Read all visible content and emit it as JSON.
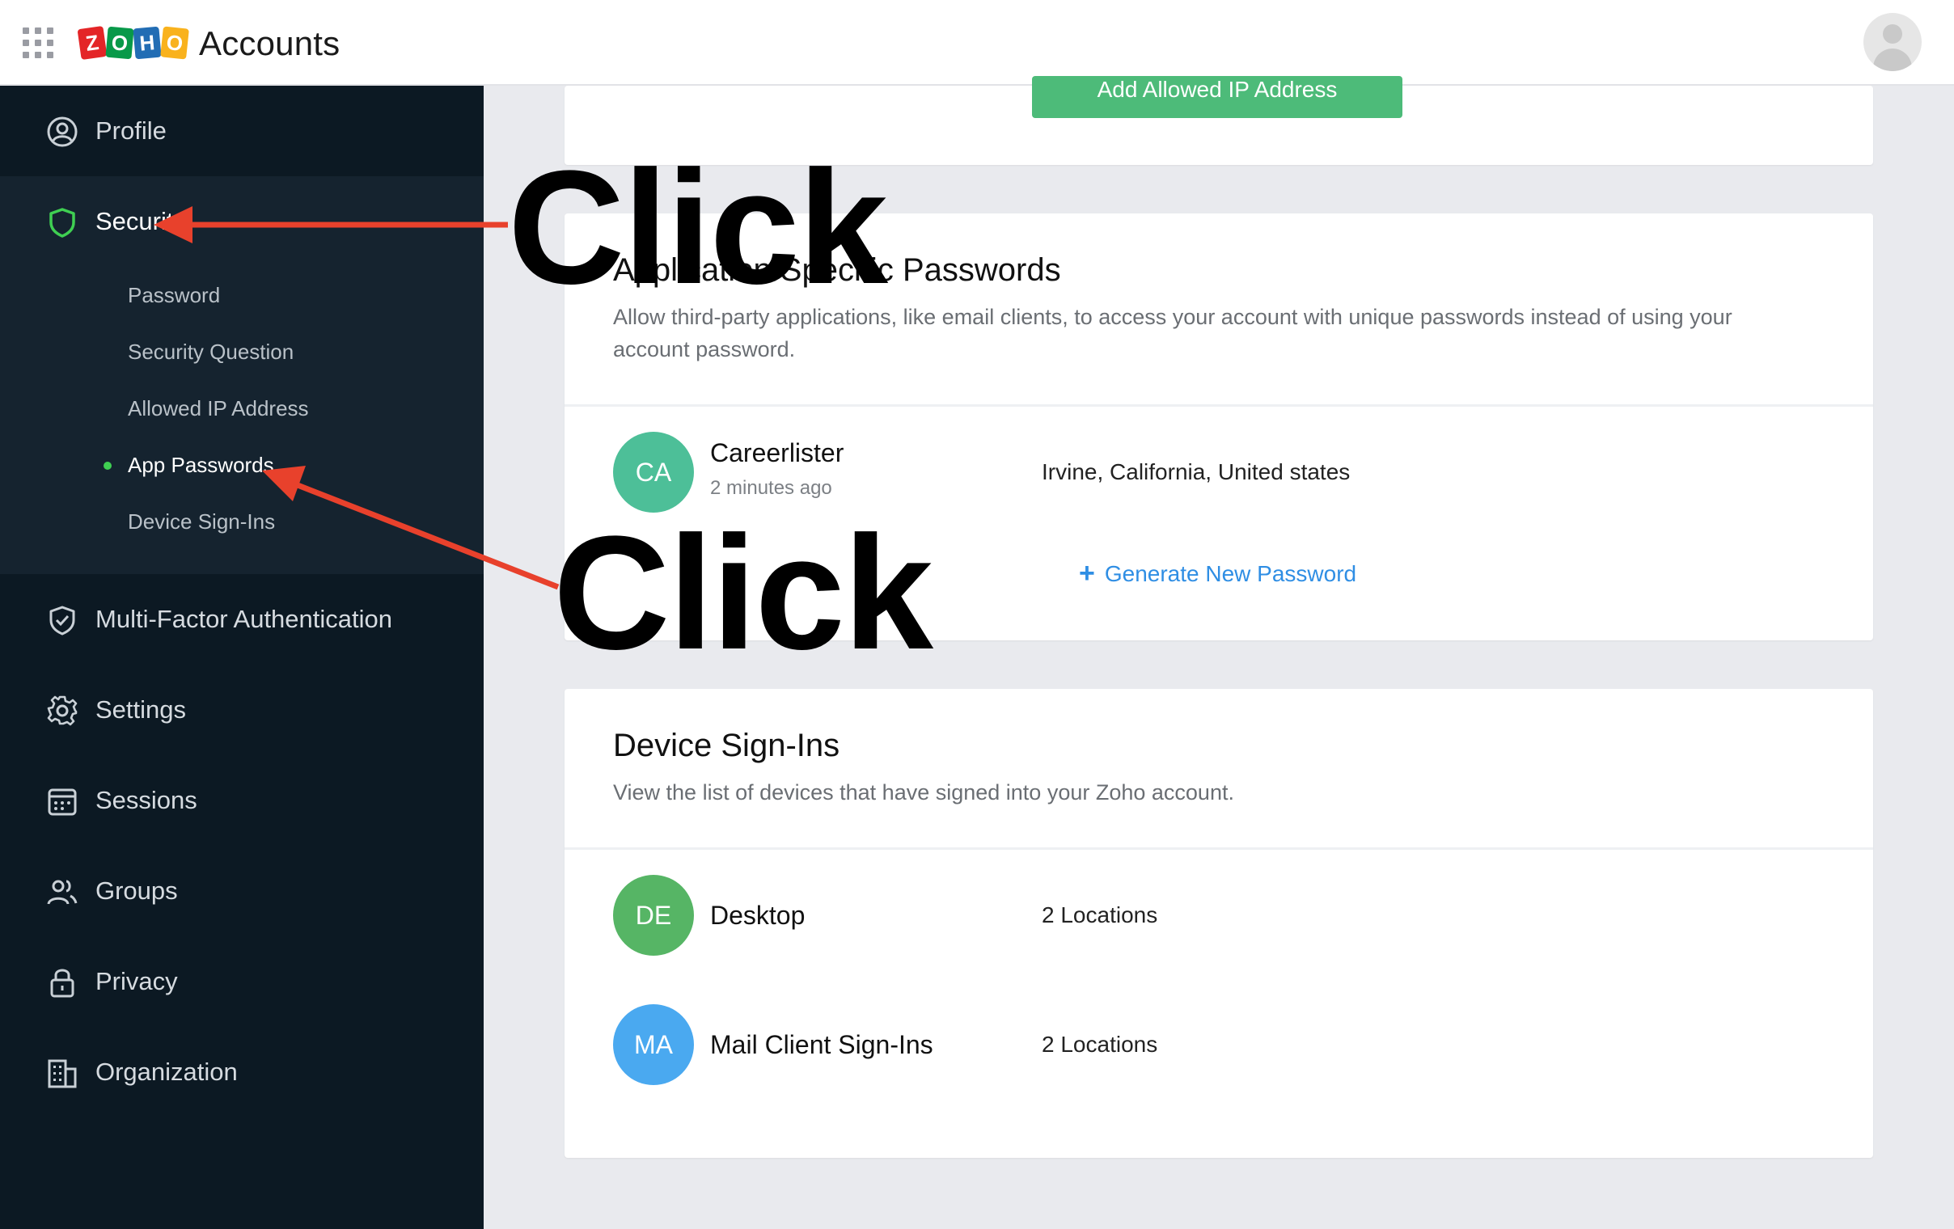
{
  "header": {
    "logo_letters": [
      "Z",
      "O",
      "H",
      "O"
    ],
    "app_title": "Accounts"
  },
  "sidebar": {
    "items": [
      {
        "label": "Profile",
        "icon": "user-circle-icon"
      },
      {
        "label": "Security",
        "visible_label": "Securit",
        "icon": "shield-icon"
      },
      {
        "label": "Multi-Factor Authentication",
        "icon": "shield-check-icon"
      },
      {
        "label": "Settings",
        "icon": "gear-icon"
      },
      {
        "label": "Sessions",
        "icon": "calendar-icon"
      },
      {
        "label": "Groups",
        "icon": "users-icon"
      },
      {
        "label": "Privacy",
        "icon": "lock-icon"
      },
      {
        "label": "Organization",
        "icon": "building-icon"
      }
    ],
    "security_sub": [
      {
        "label": "Password"
      },
      {
        "label": "Security Question"
      },
      {
        "label": "Allowed IP Address"
      },
      {
        "label": "App Passwords",
        "active": true
      },
      {
        "label": "Device Sign-Ins"
      }
    ]
  },
  "top_card": {
    "button_label": "Add Allowed IP Address"
  },
  "app_passwords": {
    "title": "Application Specific Passwords",
    "description": "Allow third-party applications, like email clients, to access your account with unique passwords instead of using your account password.",
    "entries": [
      {
        "initials": "CA",
        "name": "Careerlister",
        "time": "2 minutes ago",
        "location": "Irvine, California, United states",
        "color": "#4dbf98"
      }
    ],
    "generate_label": "Generate New Password"
  },
  "device_signins": {
    "title": "Device Sign-Ins",
    "description": "View the list of devices that have signed into your Zoho account.",
    "entries": [
      {
        "initials": "DE",
        "name": "Desktop",
        "locations": "2 Locations",
        "color": "#56b565"
      },
      {
        "initials": "MA",
        "name": "Mail Client Sign-Ins",
        "locations": "2 Locations",
        "color": "#4aa9f0"
      }
    ]
  },
  "annotations": {
    "click_1": "Click",
    "click_2": "Click",
    "arrow_color": "#e8412c"
  },
  "colors": {
    "sidebar_bg": "#0c1923",
    "active_green": "#3fcf52",
    "link_blue": "#2f8ee4",
    "button_green": "#4dbb79"
  }
}
